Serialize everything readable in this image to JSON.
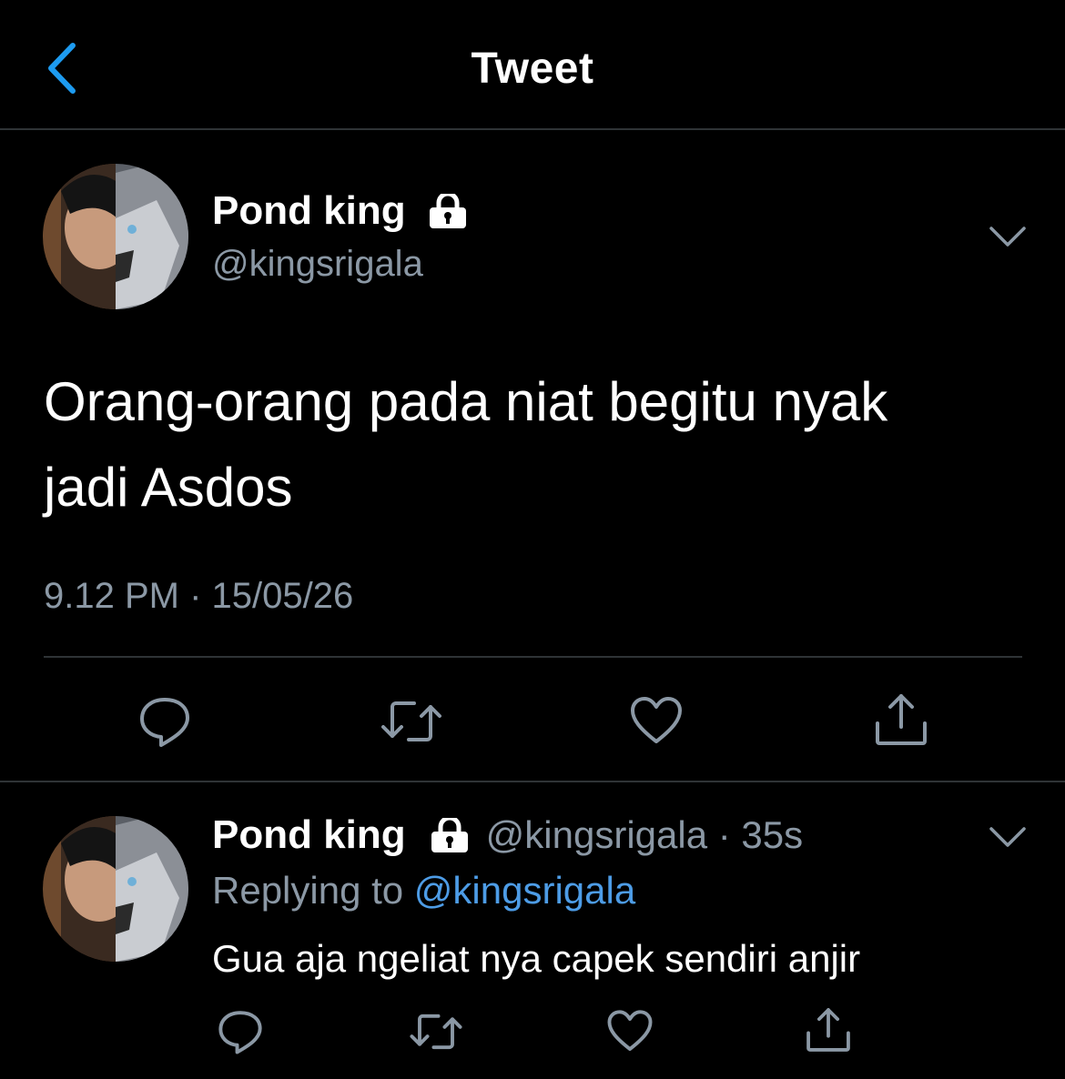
{
  "header": {
    "title": "Tweet",
    "back_icon": "chevron-left-icon"
  },
  "tweet": {
    "author_name": "Pond king",
    "author_handle": "@kingsrigala",
    "text_line1": "Orang-orang pada niat begitu nyak",
    "text_line2": "jadi Asdos",
    "timestamp": "9.12 PM · 15/05/26"
  },
  "reply": {
    "author_name": "Pond king",
    "author_handle": "@kingsrigala",
    "separator": " · ",
    "age": "35s",
    "replying_prefix": "Replying to ",
    "replying_to": "@kingsrigala",
    "text": "Gua aja ngeliat nya capek sendiri anjir"
  },
  "icons": {
    "lock": "lock-icon",
    "caret": "chevron-down-icon",
    "reply": "reply-icon",
    "retweet": "retweet-icon",
    "like": "heart-icon",
    "share": "share-icon"
  },
  "colors": {
    "background": "#000000",
    "text": "#ffffff",
    "muted": "#8b98a5",
    "link": "#4d9ce6",
    "divider": "#2f3336"
  }
}
